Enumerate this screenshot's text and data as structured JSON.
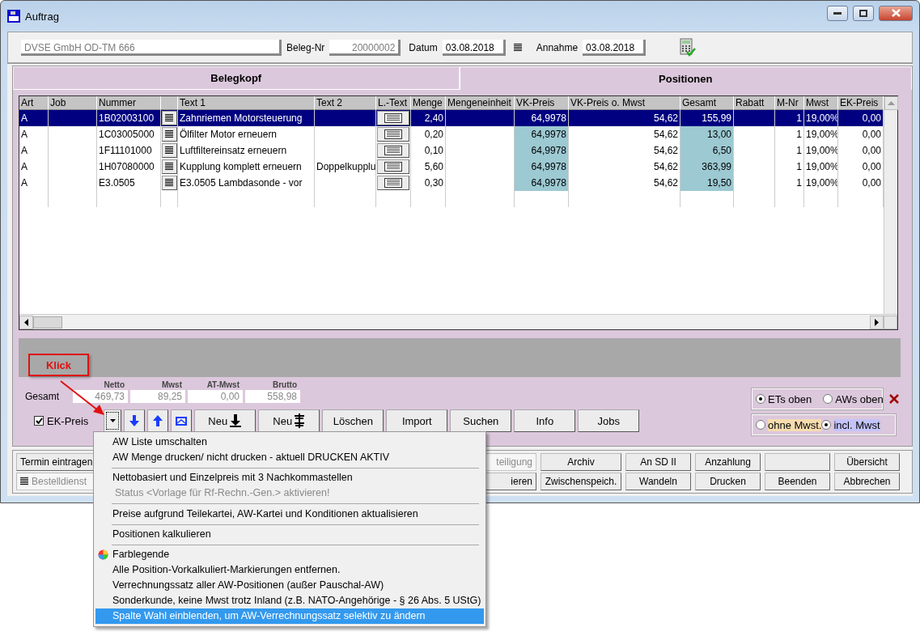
{
  "window": {
    "title": "Auftrag"
  },
  "header": {
    "customer": "DVSE GmbH OD-TM 666",
    "beleg_label": "Beleg-Nr",
    "beleg_nr": "20000002",
    "datum_label": "Datum",
    "datum": "03.08.2018",
    "annahme_label": "Annahme",
    "annahme": "03.08.2018"
  },
  "tabs": [
    {
      "label": "Belegkopf",
      "selected": false
    },
    {
      "label": "Positionen",
      "selected": true
    }
  ],
  "table": {
    "columns": [
      {
        "label": "Art",
        "kind": "text",
        "shaded": false
      },
      {
        "label": "Job",
        "kind": "text",
        "shaded": false
      },
      {
        "label": "Nummer",
        "kind": "text",
        "shaded": false
      },
      {
        "kind": "list-button",
        "shaded": false
      },
      {
        "label": "Text 1",
        "kind": "text",
        "shaded": false
      },
      {
        "label": "Text 2",
        "kind": "text",
        "shaded": false
      },
      {
        "label": "L.-Text",
        "kind": "note-button",
        "shaded": false
      },
      {
        "label": "Menge",
        "kind": "number",
        "shaded": false
      },
      {
        "label": "Mengeneinheit",
        "kind": "text",
        "shaded": false
      },
      {
        "label": "VK-Preis",
        "kind": "number",
        "shaded": true
      },
      {
        "label": "VK-Preis o. Mwst",
        "kind": "number",
        "shaded": false
      },
      {
        "label": "Gesamt",
        "kind": "number",
        "shaded": true
      },
      {
        "label": "Rabatt",
        "kind": "number",
        "shaded": false
      },
      {
        "label": "M-Nr",
        "kind": "number",
        "shaded": false
      },
      {
        "label": "Mwst",
        "kind": "text",
        "shaded": false
      },
      {
        "label": "EK-Preis",
        "kind": "number",
        "shaded": false
      }
    ],
    "rows": [
      {
        "selected": true,
        "cells": [
          "A",
          "",
          "1B02003100",
          "",
          "Zahnriemen Motorsteuerung",
          "",
          "",
          "2,40",
          "",
          "64,9978",
          "54,62",
          "155,99",
          "",
          "1",
          "19,00%",
          "0,00"
        ]
      },
      {
        "selected": false,
        "cells": [
          "A",
          "",
          "1C03005000",
          "",
          "Ölfilter Motor erneuern",
          "",
          "",
          "0,20",
          "",
          "64,9978",
          "54,62",
          "13,00",
          "",
          "1",
          "19,00%",
          "0,00"
        ]
      },
      {
        "selected": false,
        "cells": [
          "A",
          "",
          "1F11101000",
          "",
          "Luftfiltereinsatz erneuern",
          "",
          "",
          "0,10",
          "",
          "64,9978",
          "54,62",
          "6,50",
          "",
          "1",
          "19,00%",
          "0,00"
        ]
      },
      {
        "selected": false,
        "cells": [
          "A",
          "",
          "1H07080000",
          "",
          "Kupplung komplett erneuern",
          "Doppelkupplu",
          "",
          "5,60",
          "",
          "64,9978",
          "54,62",
          "363,99",
          "",
          "1",
          "19,00%",
          "0,00"
        ]
      },
      {
        "selected": false,
        "cells": [
          "A",
          "",
          "E3.0505",
          "",
          "E3.0505 Lambdasonde - vor",
          "",
          "",
          "0,30",
          "",
          "64,9978",
          "54,62",
          "19,50",
          "",
          "1",
          "19,00%",
          "0,00"
        ]
      }
    ]
  },
  "annotation": {
    "text": "Klick"
  },
  "totals": {
    "label": "Gesamt",
    "fields": [
      {
        "label": "Netto",
        "value": "469,73"
      },
      {
        "label": "Mwst",
        "value": "89,25"
      },
      {
        "label": "AT-Mwst",
        "value": "0,00"
      },
      {
        "label": "Brutto",
        "value": "558,98"
      }
    ]
  },
  "ek_preis": {
    "label": "EK-Preis",
    "checked": true
  },
  "toolbar": [
    {
      "label": "Neu",
      "kind": "down"
    },
    {
      "label": "Neu",
      "kind": "insert"
    },
    {
      "label": "Löschen",
      "kind": "plain"
    },
    {
      "label": "Import",
      "kind": "plain"
    },
    {
      "label": "Suchen",
      "kind": "plain"
    },
    {
      "label": "Info",
      "kind": "plain"
    },
    {
      "label": "Jobs",
      "kind": "plain"
    }
  ],
  "sort_radios": [
    {
      "label": "ETs oben",
      "selected": true
    },
    {
      "label": "AWs oben",
      "selected": false
    }
  ],
  "tax_radios": [
    {
      "label": "ohne Mwst.",
      "selected": false,
      "color": "#f5dcb0"
    },
    {
      "label": "incl. Mwst",
      "selected": true,
      "color": "#c4c4fa"
    }
  ],
  "bottom_buttons": [
    [
      {
        "label": "Termin eintragen",
        "disabled": false
      },
      {
        "label": "teiligung",
        "disabled": true
      },
      {
        "label": "Archiv",
        "disabled": false
      },
      {
        "label": "An SD II",
        "disabled": false
      },
      {
        "label": "Anzahlung",
        "disabled": false
      },
      {
        "disabled": false
      },
      {
        "label": "Übersicht",
        "disabled": false
      }
    ],
    [
      {
        "label": "Bestelldienst",
        "disabled": true,
        "icon": true
      },
      {
        "label": "ieren",
        "disabled": false
      },
      {
        "label": "Zwischenspeich.",
        "disabled": false
      },
      {
        "label": "Wandeln",
        "disabled": false
      },
      {
        "label": "Drucken",
        "disabled": false
      },
      {
        "label": "Beenden",
        "disabled": false
      },
      {
        "label": "Abbrechen",
        "disabled": false
      }
    ]
  ],
  "menu": [
    {
      "kind": "item",
      "label": "AW Liste umschalten",
      "disabled": false,
      "selected": false
    },
    {
      "kind": "item",
      "label": "AW Menge drucken/ nicht drucken - aktuell DRUCKEN AKTIV",
      "disabled": false,
      "selected": false
    },
    {
      "kind": "separator"
    },
    {
      "kind": "item",
      "label": "Nettobasiert und Einzelpreis mit 3 Nachkommastellen",
      "disabled": false,
      "selected": false
    },
    {
      "kind": "item",
      "label": "Status <Vorlage für Rf-Rechn.-Gen.> aktivieren!",
      "disabled": true,
      "selected": false
    },
    {
      "kind": "separator"
    },
    {
      "kind": "item",
      "label": "Preise aufgrund Teilekartei, AW-Kartei und Konditionen aktualisieren",
      "disabled": false,
      "selected": false
    },
    {
      "kind": "separator"
    },
    {
      "kind": "item",
      "label": "Positionen kalkulieren",
      "disabled": false,
      "selected": false
    },
    {
      "kind": "separator"
    },
    {
      "kind": "icon-item",
      "label": "Farblegende",
      "disabled": false,
      "selected": false
    },
    {
      "kind": "item",
      "label": "Alle Position-Vorkalkuliert-Markierungen entfernen.",
      "disabled": false,
      "selected": false
    },
    {
      "kind": "item",
      "label": "Verrechnungssatz aller AW-Positionen (außer Pauschal-AW)",
      "disabled": false,
      "selected": false
    },
    {
      "kind": "item",
      "label": "Sonderkunde, keine Mwst trotz Inland (z.B. NATO-Angehörige - § 26 Abs. 5 UStG)",
      "disabled": false,
      "selected": false
    },
    {
      "kind": "item",
      "label": "Spalte Wahl einblenden, um AW-Verrechnungssatz selektiv zu ändern",
      "disabled": false,
      "selected": true
    }
  ]
}
